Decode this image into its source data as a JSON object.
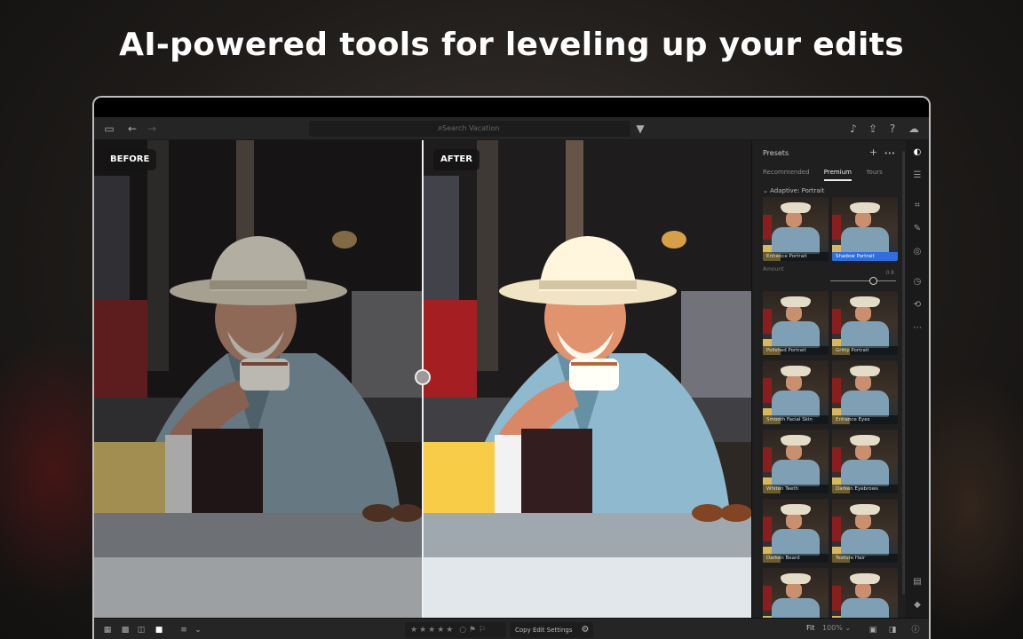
{
  "headline": "AI-powered tools for leveling up your edits",
  "topbar": {
    "search_placeholder": "Search Vacation"
  },
  "compare": {
    "before_label": "BEFORE",
    "after_label": "AFTER"
  },
  "presets": {
    "title": "Presets",
    "add_icon": "+",
    "more_icon": "•••",
    "tabs": [
      {
        "label": "Recommended",
        "active": false
      },
      {
        "label": "Premium",
        "active": true
      },
      {
        "label": "Yours",
        "active": false
      }
    ],
    "section": "Adaptive: Portrait",
    "amount_label": "Amount",
    "amount_value": "0.8",
    "amount_fraction": 0.65,
    "items": [
      {
        "label": "Enhance Portrait",
        "selected": false
      },
      {
        "label": "Shadow Portrait",
        "selected": true
      },
      {
        "label": "Polished Portrait",
        "selected": false
      },
      {
        "label": "Gritty Portrait",
        "selected": false
      },
      {
        "label": "Smooth Facial Skin",
        "selected": false
      },
      {
        "label": "Enhance Eyes",
        "selected": false
      },
      {
        "label": "Whiten Teeth",
        "selected": false
      },
      {
        "label": "Darken Eyebrows",
        "selected": false
      },
      {
        "label": "Darken Beard",
        "selected": false
      },
      {
        "label": "Texture Hair",
        "selected": false
      },
      {
        "label": "",
        "selected": false
      },
      {
        "label": "",
        "selected": false
      }
    ]
  },
  "bottombar": {
    "stars": "★★★★★",
    "copy_label": "Copy Edit Settings",
    "zoom_fit": "Fit",
    "zoom_pct": "100%"
  },
  "colors": {
    "accent": "#2f6ee0",
    "panel": "#1f1f1f",
    "bar": "#252525"
  }
}
